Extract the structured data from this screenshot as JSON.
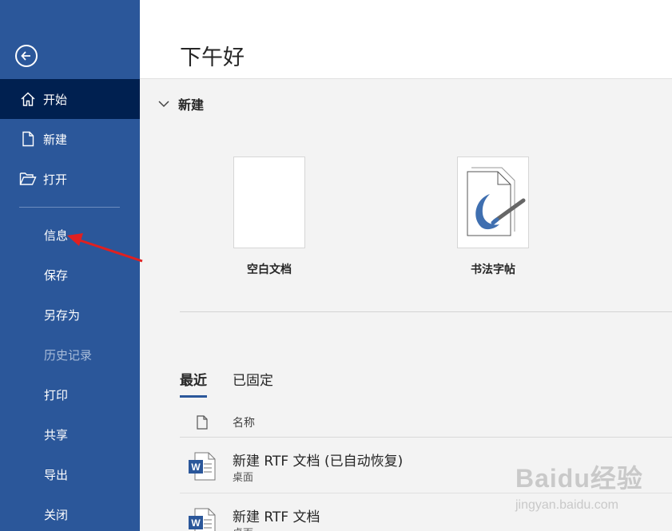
{
  "sidebar": {
    "back_icon": "back-arrow-icon",
    "items": [
      {
        "label": "开始",
        "icon": "home-icon"
      },
      {
        "label": "新建",
        "icon": "new-document-icon"
      },
      {
        "label": "打开",
        "icon": "open-folder-icon"
      },
      {
        "label": "信息"
      },
      {
        "label": "保存"
      },
      {
        "label": "另存为"
      },
      {
        "label": "历史记录"
      },
      {
        "label": "打印"
      },
      {
        "label": "共享"
      },
      {
        "label": "导出"
      },
      {
        "label": "关闭"
      }
    ]
  },
  "main": {
    "greeting": "下午好",
    "new_section": {
      "title": "新建",
      "templates": [
        {
          "name": "空白文档"
        },
        {
          "name": "书法字帖"
        }
      ]
    },
    "tabs": [
      {
        "label": "最近",
        "active": true
      },
      {
        "label": "已固定",
        "active": false
      }
    ],
    "list": {
      "column_name": "名称",
      "files": [
        {
          "name": "新建 RTF 文档 (已自动恢复)",
          "location": "桌面"
        },
        {
          "name": "新建 RTF 文档",
          "location": "桌面"
        }
      ]
    }
  },
  "watermark": {
    "brand": "Baidu经验",
    "url": "jingyan.baidu.com"
  },
  "colors": {
    "sidebar_bg": "#2b579a",
    "sidebar_active": "#002050",
    "annotation_arrow": "#e02020"
  }
}
